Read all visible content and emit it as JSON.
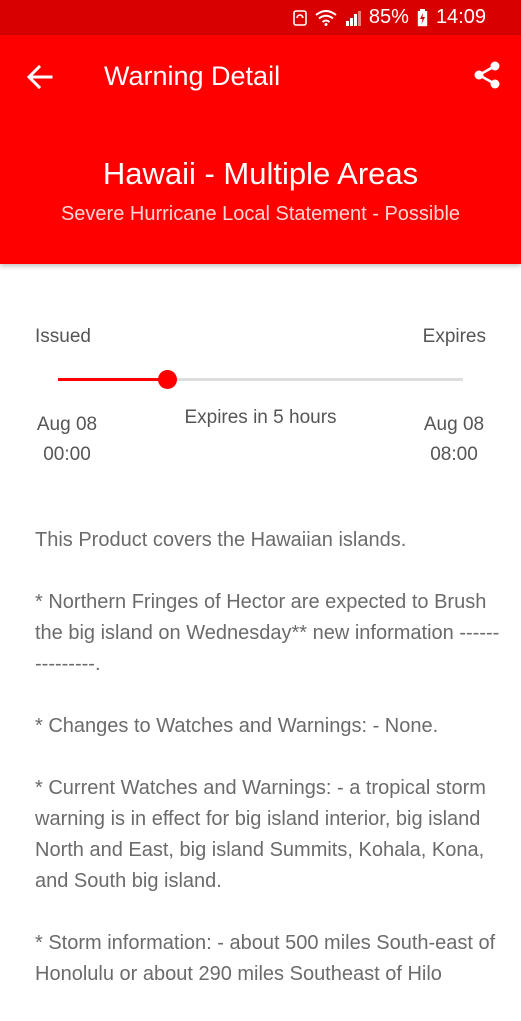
{
  "status_bar": {
    "battery_percent": "85%",
    "time": "14:09",
    "icons": [
      "sync-icon",
      "wifi-icon",
      "signal-icon",
      "battery-charging-icon"
    ]
  },
  "app_bar": {
    "title": "Warning Detail",
    "back_icon": "arrow-back-icon",
    "share_icon": "share-icon"
  },
  "header": {
    "title": "Hawaii - Multiple Areas",
    "subtitle": "Severe Hurricane Local Statement - Possible"
  },
  "timeline": {
    "issued_label": "Issued",
    "expires_label": "Expires",
    "progress_fraction": 0.27,
    "expires_in": "Expires in 5 hours",
    "issued_date": "Aug 08",
    "issued_time": "00:00",
    "expires_date": "Aug 08",
    "expires_time": "08:00"
  },
  "body": {
    "paragraphs": [
      "This Product covers the Hawaiian islands.",
      "* Northern Fringes of Hector are expected to Brush the big island on Wednesday** new information ---------------.",
      "* Changes to Watches and Warnings: - None.",
      "* Current Watches and Warnings: - a tropical storm warning is in effect for big island interior, big island North and East, big island Summits, Kohala, Kona, and South big island.",
      "* Storm information: - about 500 miles South-east of Honolulu or about 290 miles Southeast of Hilo"
    ]
  },
  "colors": {
    "primary": "#ff0000",
    "status_bar": "#d80000",
    "text_muted": "#6b6b6b"
  }
}
